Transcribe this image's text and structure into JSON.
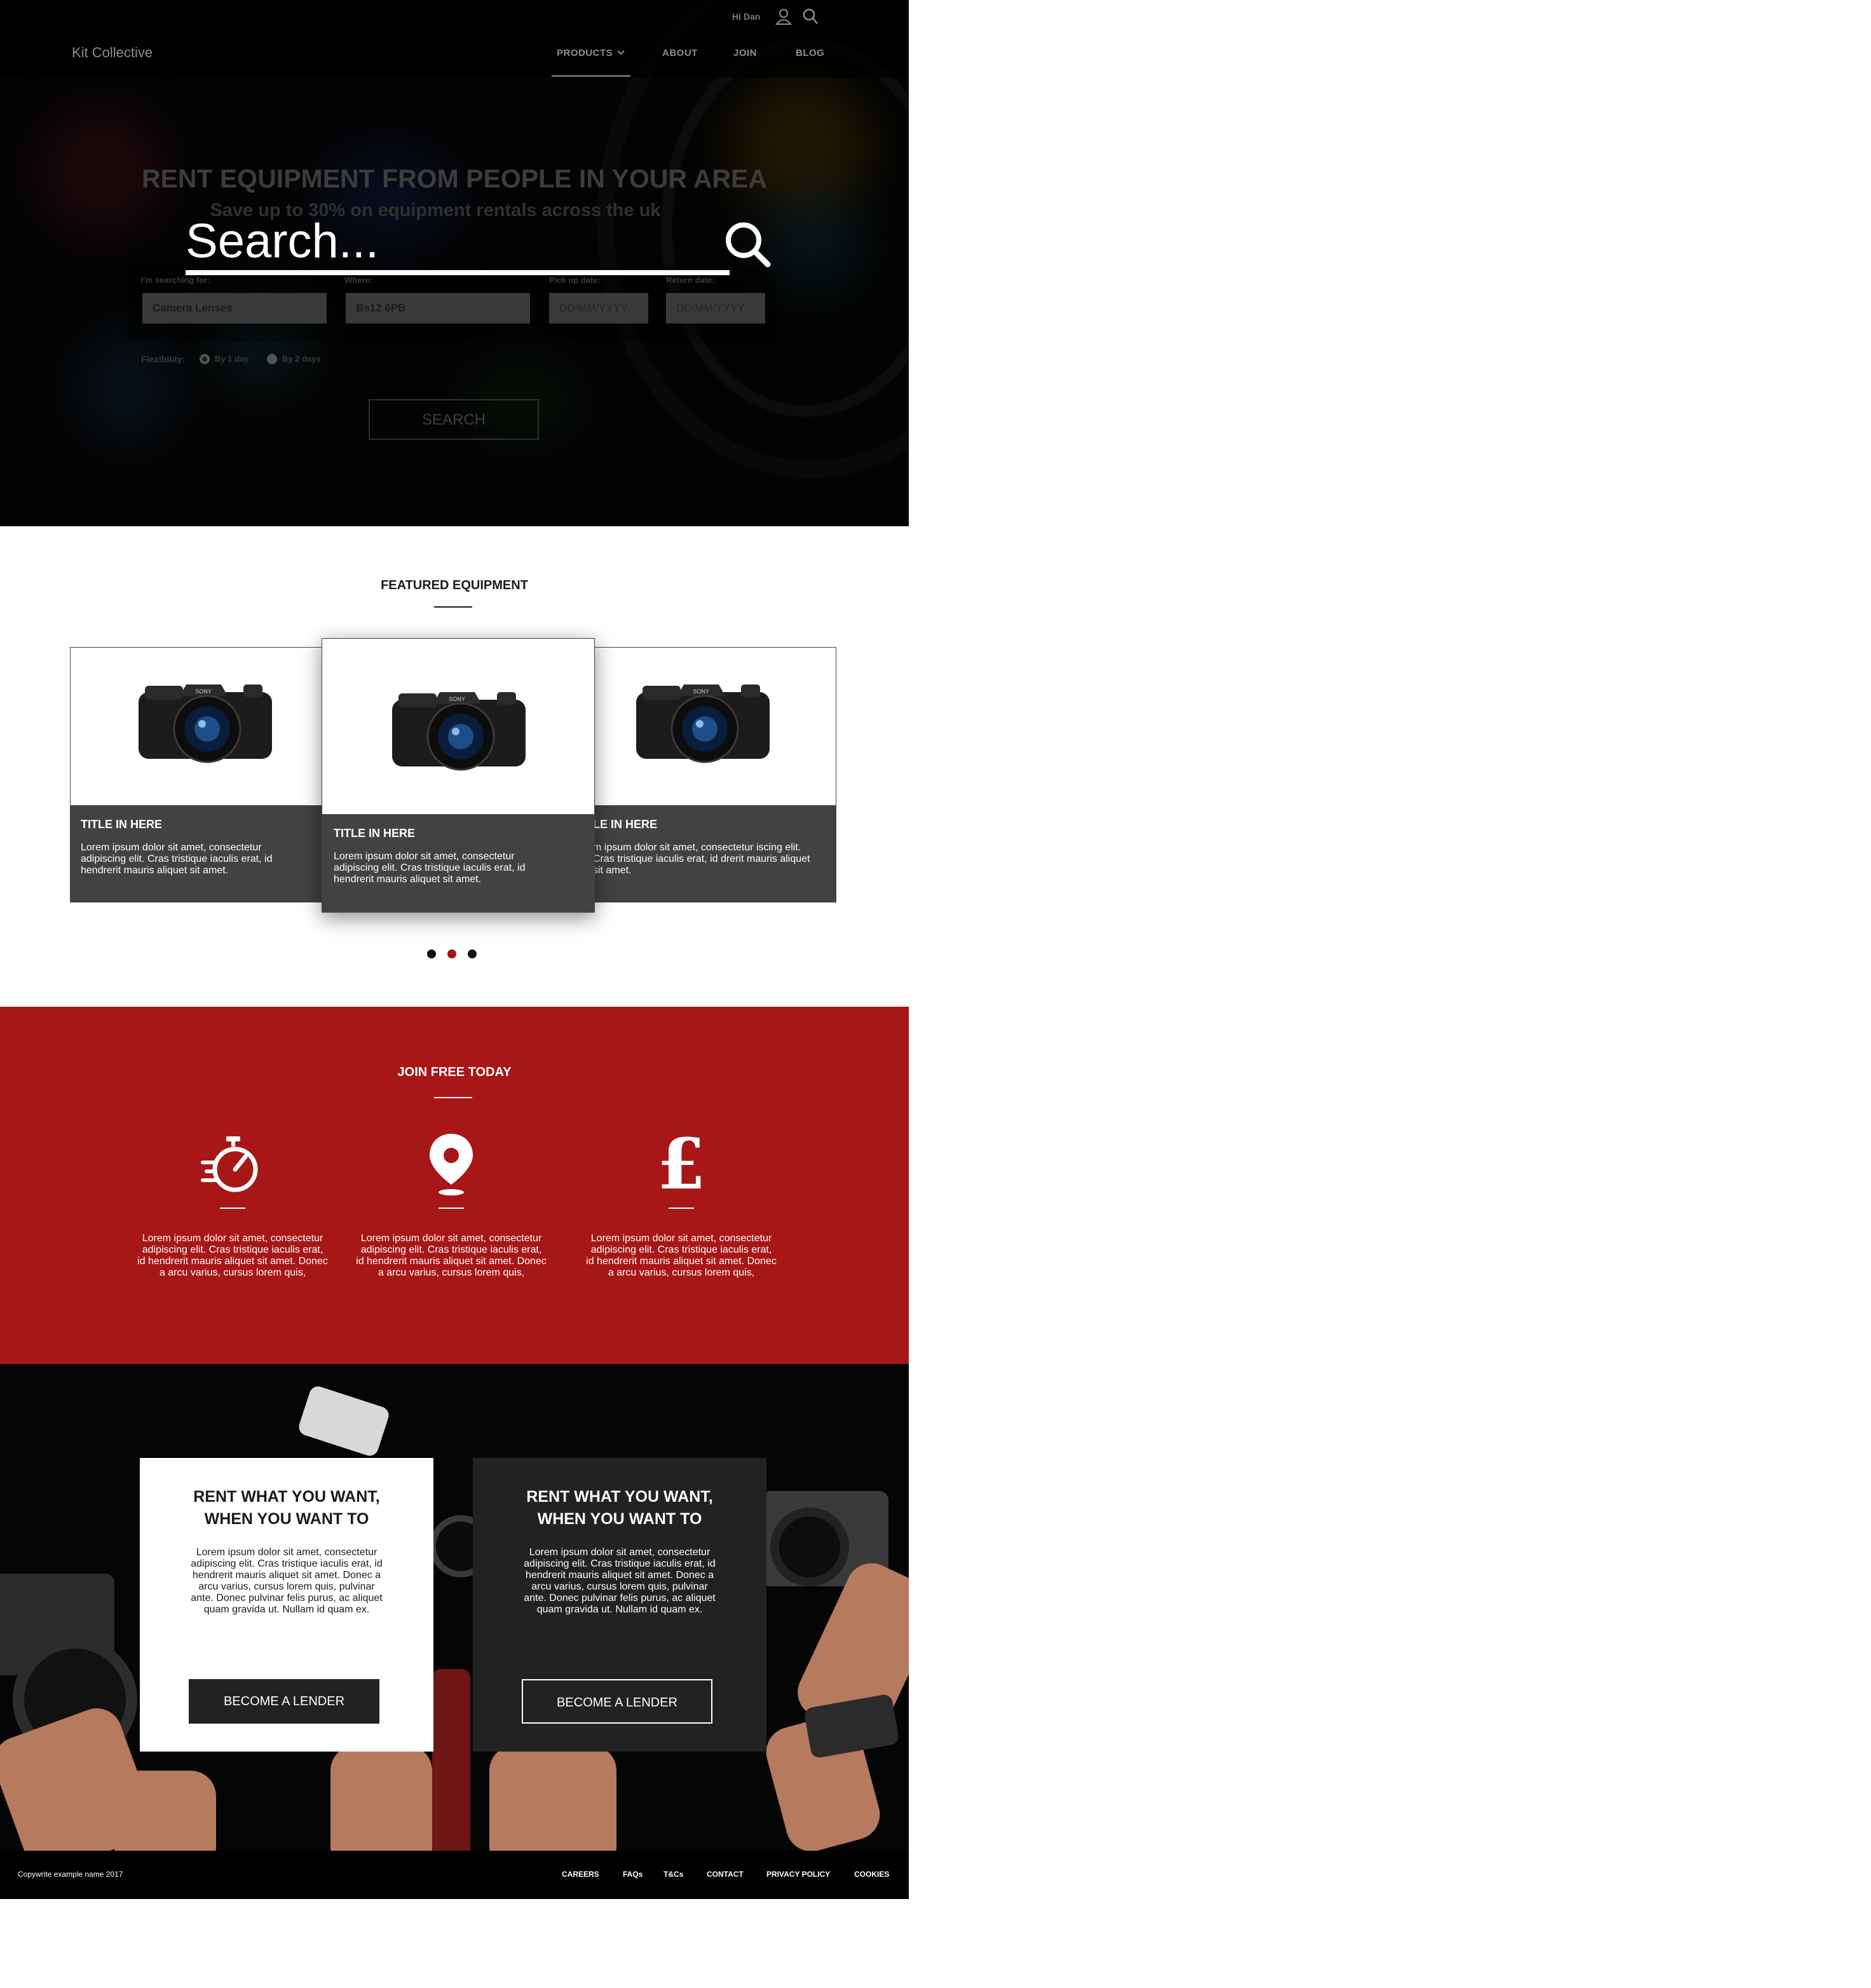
{
  "header": {
    "greeting": "Hi Dan",
    "brand": "Kit Collective",
    "nav": {
      "products": "PRODUCTS",
      "about": "ABOUT",
      "join": "JOIN",
      "blog": "BLOG"
    }
  },
  "hero": {
    "title": "RENT EQUIPMENT FROM PEOPLE IN YOUR AREA",
    "subtitle": "Save up to 30% on equipment rentals across the uk",
    "search_overlay": "Search...",
    "form": {
      "searching_label": "I'm searching for:",
      "searching_value": "Camera Lenses",
      "where_label": "Where:",
      "where_value": "Bs12 6PB",
      "pickup_label": "Pick up date:",
      "pickup_placeholder": "DD/MM/YYYY",
      "return_label": "Return date:",
      "return_placeholder": "DD/MM/YYYY",
      "flexibility_label": "Flexibility:",
      "flex_option_1": "By 1 day",
      "flex_option_2": "By 2 days",
      "search_button": "SEARCH"
    }
  },
  "featured": {
    "title": "FEATURED EQUIPMENT",
    "cards": [
      {
        "title": "TITLE IN HERE",
        "body": "Lorem ipsum dolor sit amet, consectetur adipiscing elit. Cras tristique iaculis erat, id hendrerit mauris aliquet sit amet."
      },
      {
        "title": "TITLE IN HERE",
        "body": "Lorem ipsum dolor sit amet, consectetur adipiscing elit. Cras tristique iaculis erat, id hendrerit mauris aliquet sit amet."
      },
      {
        "title": "LE IN HERE",
        "body": "m ipsum dolor sit amet, consectetur iscing elit. Cras tristique iaculis erat, id drerit mauris aliquet sit amet."
      }
    ],
    "carousel_active_index": 2
  },
  "join": {
    "title": "JOIN FREE TODAY",
    "features": [
      {
        "icon": "stopwatch-icon",
        "text": "Lorem ipsum dolor sit amet, consectetur adipiscing elit. Cras tristique iaculis erat, id hendrerit mauris aliquet sit amet. Donec a arcu varius, cursus lorem quis,"
      },
      {
        "icon": "location-pin-icon",
        "text": "Lorem ipsum dolor sit amet, consectetur adipiscing elit. Cras tristique iaculis erat, id hendrerit mauris aliquet sit amet. Donec a arcu varius, cursus lorem quis,"
      },
      {
        "icon": "pound-icon",
        "text": "Lorem ipsum dolor sit amet, consectetur adipiscing elit. Cras tristique iaculis erat, id hendrerit mauris aliquet sit amet. Donec a arcu varius, cursus lorem quis,"
      }
    ]
  },
  "lender": {
    "cards": [
      {
        "title_line1": "RENT WHAT YOU WANT,",
        "title_line2": "WHEN YOU WANT TO",
        "body": "Lorem ipsum dolor sit amet, consectetur adipiscing elit. Cras tristique iaculis erat, id hendrerit mauris aliquet sit amet. Donec a arcu varius, cursus lorem quis, pulvinar ante. Donec pulvinar felis purus, ac aliquet quam gravida ut. Nullam id quam ex.",
        "button": "BECOME A LENDER"
      },
      {
        "title_line1": "RENT WHAT YOU WANT,",
        "title_line2": "WHEN YOU WANT TO",
        "body": "Lorem ipsum dolor sit amet, consectetur adipiscing elit. Cras tristique iaculis erat, id hendrerit mauris aliquet sit amet. Donec a arcu varius, cursus lorem quis, pulvinar ante. Donec pulvinar felis purus, ac aliquet quam gravida ut. Nullam id quam ex.",
        "button": "BECOME A LENDER"
      }
    ]
  },
  "footer": {
    "copyright": "Copywrite example name 2017",
    "links": {
      "careers": "CAREERS",
      "faqs": "FAQs",
      "tcs": "T&Cs",
      "contact": "CONTACT",
      "privacy": "PRIVACY POLICY",
      "cookies": "COOKIES"
    }
  },
  "colors": {
    "accent_red": "#a81717",
    "dark_card": "#424242",
    "footer_bg": "#000000"
  }
}
